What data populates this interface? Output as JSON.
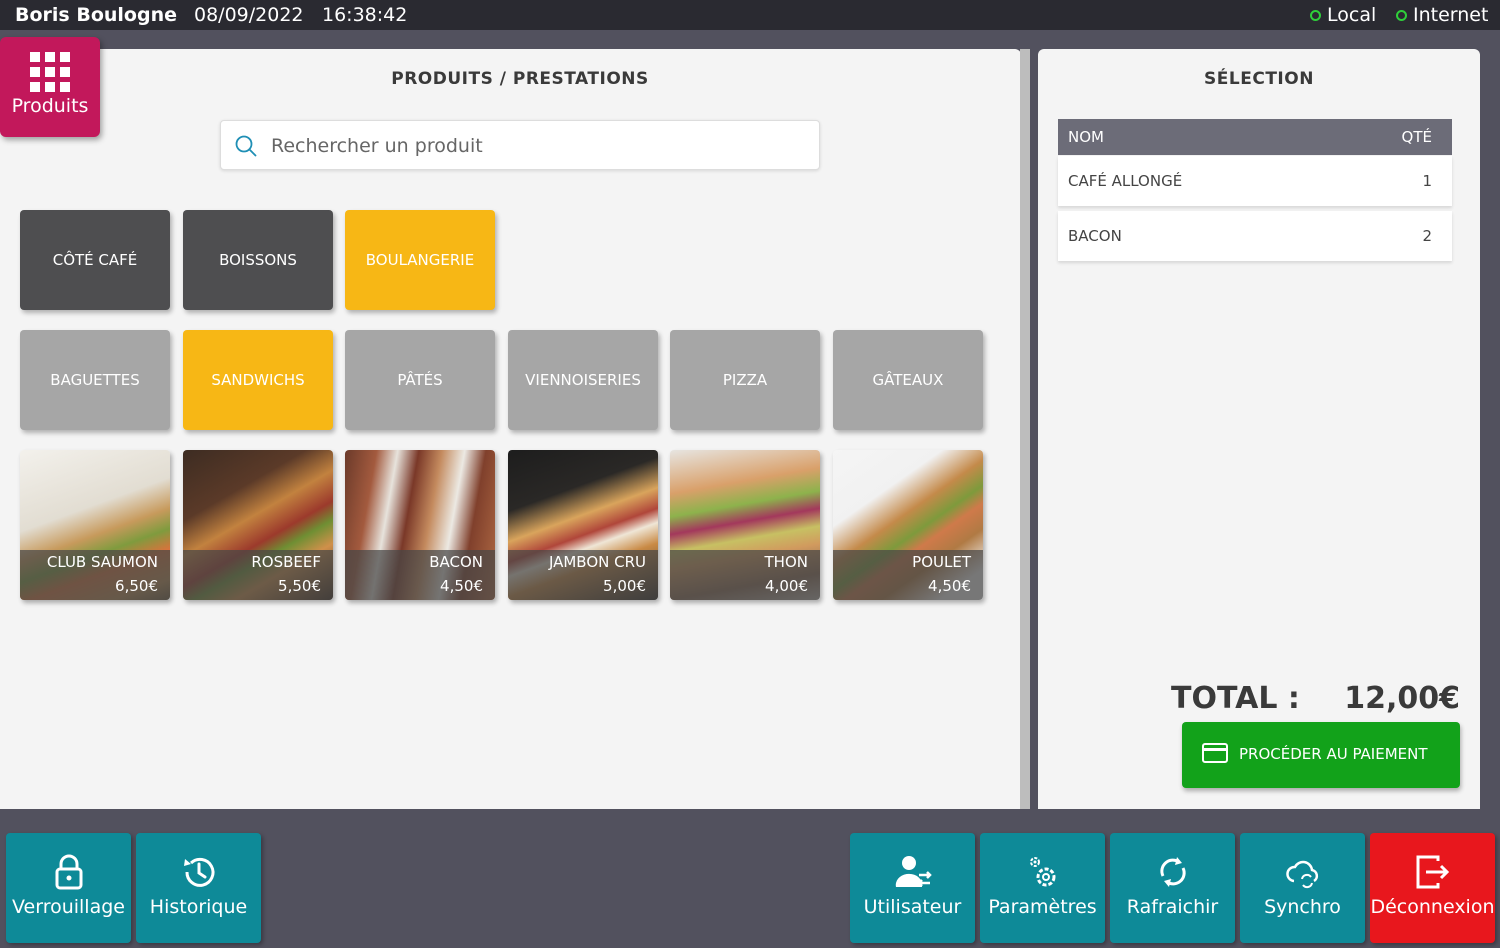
{
  "topbar": {
    "user": "Boris Boulogne",
    "date": "08/09/2022",
    "time": "16:38:42",
    "local": "Local",
    "internet": "Internet",
    "status_color": "#2fcf3a"
  },
  "produits_tab": {
    "label": "Produits",
    "icon": "grid-icon",
    "color": "#c2185b"
  },
  "products_panel": {
    "title": "PRODUITS / PRESTATIONS",
    "search_placeholder": "Rechercher un produit",
    "categories": [
      {
        "label": "CÔTÉ CAFÉ",
        "active": false
      },
      {
        "label": "BOISSONS",
        "active": false
      },
      {
        "label": "BOULANGERIE",
        "active": true
      }
    ],
    "subcategories": [
      {
        "label": "BAGUETTES",
        "active": false
      },
      {
        "label": "SANDWICHS",
        "active": true
      },
      {
        "label": "PÂTÉS",
        "active": false
      },
      {
        "label": "VIENNOISERIES",
        "active": false
      },
      {
        "label": "PIZZA",
        "active": false
      },
      {
        "label": "GÂTEAUX",
        "active": false
      }
    ],
    "products": [
      {
        "name": "CLUB SAUMON",
        "price": "6,50€"
      },
      {
        "name": "ROSBEEF",
        "price": "5,50€"
      },
      {
        "name": "BACON",
        "price": "4,50€"
      },
      {
        "name": "JAMBON CRU",
        "price": "5,00€"
      },
      {
        "name": "THON",
        "price": "4,00€"
      },
      {
        "name": "POULET",
        "price": "4,50€"
      }
    ]
  },
  "selection": {
    "title": "SÉLECTION",
    "col_name": "NOM",
    "col_qty": "QTÉ",
    "rows": [
      {
        "name": "CAFÉ ALLONGÉ",
        "qty": "1"
      },
      {
        "name": "BACON",
        "qty": "2"
      }
    ],
    "total_label": "TOTAL :",
    "total_value": "12,00€",
    "pay_label": "PROCÉDER AU PAIEMENT"
  },
  "bottom": {
    "lock": "Verrouillage",
    "history": "Historique",
    "user": "Utilisateur",
    "settings": "Paramètres",
    "refresh": "Rafraichir",
    "sync": "Synchro",
    "logout": "Déconnexion"
  },
  "colors": {
    "accent_yellow": "#f7b715",
    "teal": "#0e8a98",
    "red": "#e8171d",
    "green": "#12a21a"
  }
}
